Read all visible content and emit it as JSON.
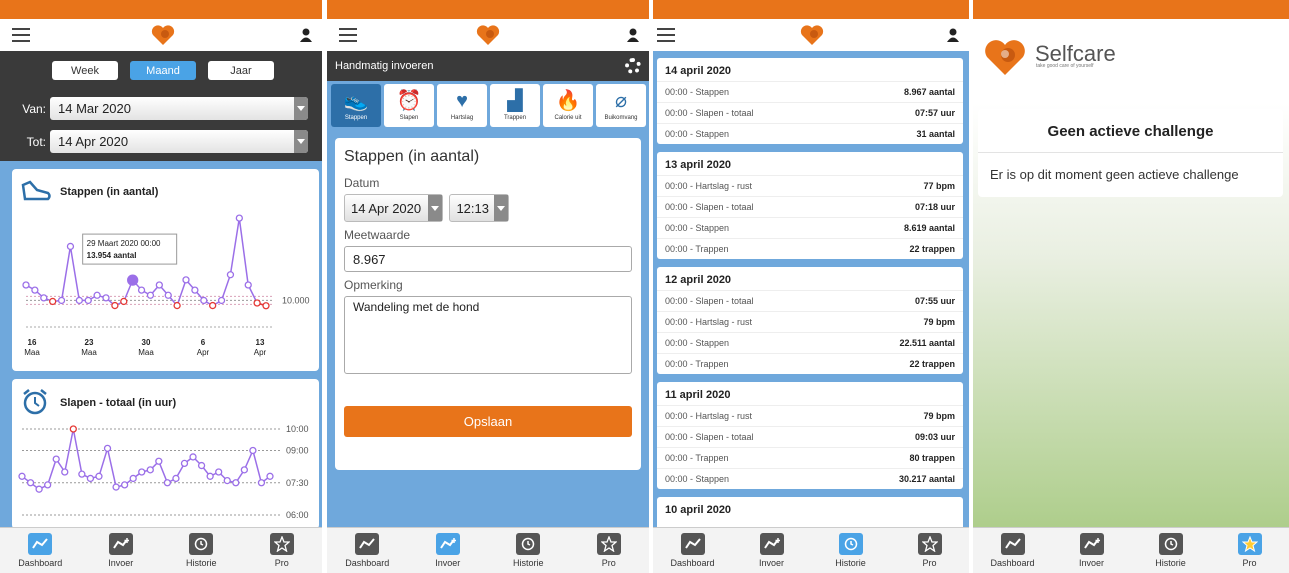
{
  "nav": [
    {
      "label": "Dashboard",
      "icon": "dashboard-icon"
    },
    {
      "label": "Invoer",
      "icon": "invoer-icon"
    },
    {
      "label": "Historie",
      "icon": "historie-icon"
    },
    {
      "label": "Pro",
      "icon": "star-icon"
    }
  ],
  "dashboard": {
    "periods": [
      "Week",
      "Maand",
      "Jaar"
    ],
    "active_period": "Maand",
    "van_label": "Van:",
    "van_value": "14 Mar 2020",
    "tot_label": "Tot:",
    "tot_value": "14 Apr 2020"
  },
  "chart_data": [
    {
      "type": "line",
      "title": "Stappen (in aantal)",
      "x_ticks": [
        "16 Maa",
        "23 Maa",
        "30 Maa",
        "6 Apr",
        "13 Apr"
      ],
      "y_ticks": [
        "10.000"
      ],
      "reference_line": 10000,
      "tooltip": {
        "date": "29 Maart 2020 00:00",
        "value": "13.954 aantal"
      },
      "values": [
        13000,
        12000,
        10500,
        9800,
        10000,
        20500,
        10000,
        10000,
        11000,
        10500,
        9000,
        9800,
        13954,
        12000,
        11000,
        13000,
        11000,
        9000,
        14000,
        12000,
        10000,
        9000,
        10000,
        15000,
        26000,
        13000,
        9500,
        8967
      ]
    },
    {
      "type": "line",
      "title": "Slapen - totaal (in uur)",
      "y_ticks": [
        "10:00",
        "09:00",
        "07:30",
        "06:00"
      ],
      "values": [
        7.8,
        7.5,
        7.2,
        7.4,
        8.6,
        8.0,
        10.0,
        7.9,
        7.7,
        7.8,
        9.1,
        7.3,
        7.4,
        7.7,
        8.0,
        8.1,
        8.5,
        7.5,
        7.7,
        8.4,
        8.7,
        8.3,
        7.8,
        8.0,
        7.6,
        7.5,
        8.1,
        9.0,
        7.5,
        7.8
      ]
    }
  ],
  "invoer": {
    "header": "Handmatig invoeren",
    "tabs": [
      {
        "label": "Stappen",
        "glyph": "👟"
      },
      {
        "label": "Slapen",
        "glyph": "⏰"
      },
      {
        "label": "Hartslag",
        "glyph": "♥"
      },
      {
        "label": "Trappen",
        "glyph": "▟"
      },
      {
        "label": "Calorie uit",
        "glyph": "🔥"
      },
      {
        "label": "Buikomvang",
        "glyph": "⌀"
      }
    ],
    "form_title": "Stappen (in aantal)",
    "datum_label": "Datum",
    "date_value": "14 Apr 2020",
    "time_value": "12:13",
    "meetwaarde_label": "Meetwaarde",
    "meetwaarde_value": "8.967",
    "opmerking_label": "Opmerking",
    "opmerking_value": "Wandeling met de hond",
    "save_label": "Opslaan"
  },
  "historie": {
    "days": [
      {
        "date": "14 april 2020",
        "entries": [
          {
            "label": "00:00 - Stappen",
            "value": "8.967 aantal"
          },
          {
            "label": "00:00 - Slapen - totaal",
            "value": "07:57 uur"
          },
          {
            "label": "00:00 - Stappen",
            "value": "31 aantal"
          }
        ]
      },
      {
        "date": "13 april 2020",
        "entries": [
          {
            "label": "00:00 - Hartslag - rust",
            "value": "77 bpm"
          },
          {
            "label": "00:00 - Slapen - totaal",
            "value": "07:18 uur"
          },
          {
            "label": "00:00 - Stappen",
            "value": "8.619 aantal"
          },
          {
            "label": "00:00 - Trappen",
            "value": "22 trappen"
          }
        ]
      },
      {
        "date": "12 april 2020",
        "entries": [
          {
            "label": "00:00 - Slapen - totaal",
            "value": "07:55 uur"
          },
          {
            "label": "00:00 - Hartslag - rust",
            "value": "79 bpm"
          },
          {
            "label": "00:00 - Stappen",
            "value": "22.511 aantal"
          },
          {
            "label": "00:00 - Trappen",
            "value": "22 trappen"
          }
        ]
      },
      {
        "date": "11 april 2020",
        "entries": [
          {
            "label": "00:00 - Hartslag - rust",
            "value": "79 bpm"
          },
          {
            "label": "00:00 - Slapen - totaal",
            "value": "09:03 uur"
          },
          {
            "label": "00:00 - Trappen",
            "value": "80 trappen"
          },
          {
            "label": "00:00 - Stappen",
            "value": "30.217 aantal"
          }
        ]
      },
      {
        "date": "10 april 2020",
        "entries": []
      }
    ]
  },
  "pro": {
    "brand_name": "Selfcare",
    "brand_tagline": "take good care of yourself",
    "challenge_title": "Geen actieve challenge",
    "challenge_text": "Er is op dit moment geen actieve challenge"
  },
  "colors": {
    "orange": "#e8741a",
    "blue": "#4aa3e6",
    "purple": "#9b6fe8",
    "red": "#e53935"
  }
}
